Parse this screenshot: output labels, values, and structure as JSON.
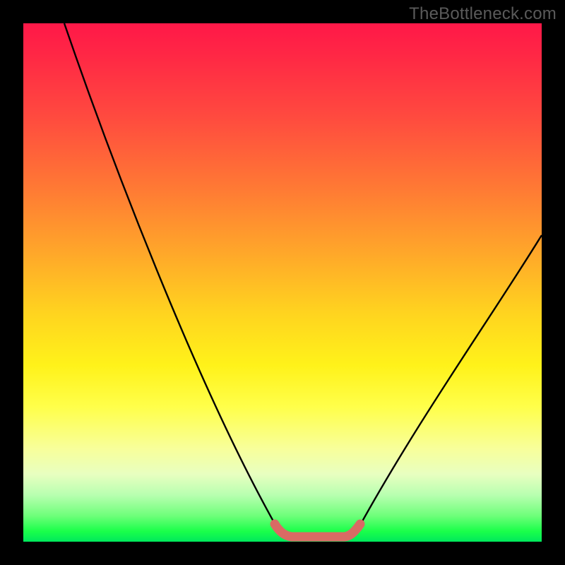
{
  "watermark": "TheBottleneck.com",
  "chart_data": {
    "type": "line",
    "title": "",
    "xlabel": "",
    "ylabel": "",
    "xlim": [
      0,
      100
    ],
    "ylim": [
      0,
      100
    ],
    "series": [
      {
        "name": "left-descending-curve",
        "x": [
          8,
          20,
          32,
          44,
          49
        ],
        "y": [
          100,
          72,
          42,
          12,
          2
        ]
      },
      {
        "name": "valley-floor",
        "x": [
          49,
          51,
          54,
          58,
          61,
          63
        ],
        "y": [
          2,
          1,
          1,
          1,
          1,
          2
        ]
      },
      {
        "name": "right-ascending-curve",
        "x": [
          63,
          75,
          87,
          100
        ],
        "y": [
          2,
          18,
          38,
          59
        ]
      }
    ],
    "highlight_segment": {
      "name": "valley-highlight",
      "color": "#d96a64",
      "x": [
        49,
        51,
        54,
        58,
        61,
        63
      ],
      "y": [
        2,
        1,
        1,
        1,
        1,
        2
      ]
    },
    "gradient_stops": [
      {
        "pos": 0,
        "color": "#ff1848"
      },
      {
        "pos": 18,
        "color": "#ff4a3f"
      },
      {
        "pos": 44,
        "color": "#ffa62a"
      },
      {
        "pos": 66,
        "color": "#fff21a"
      },
      {
        "pos": 87,
        "color": "#e8ffc0"
      },
      {
        "pos": 100,
        "color": "#00e85c"
      }
    ]
  }
}
